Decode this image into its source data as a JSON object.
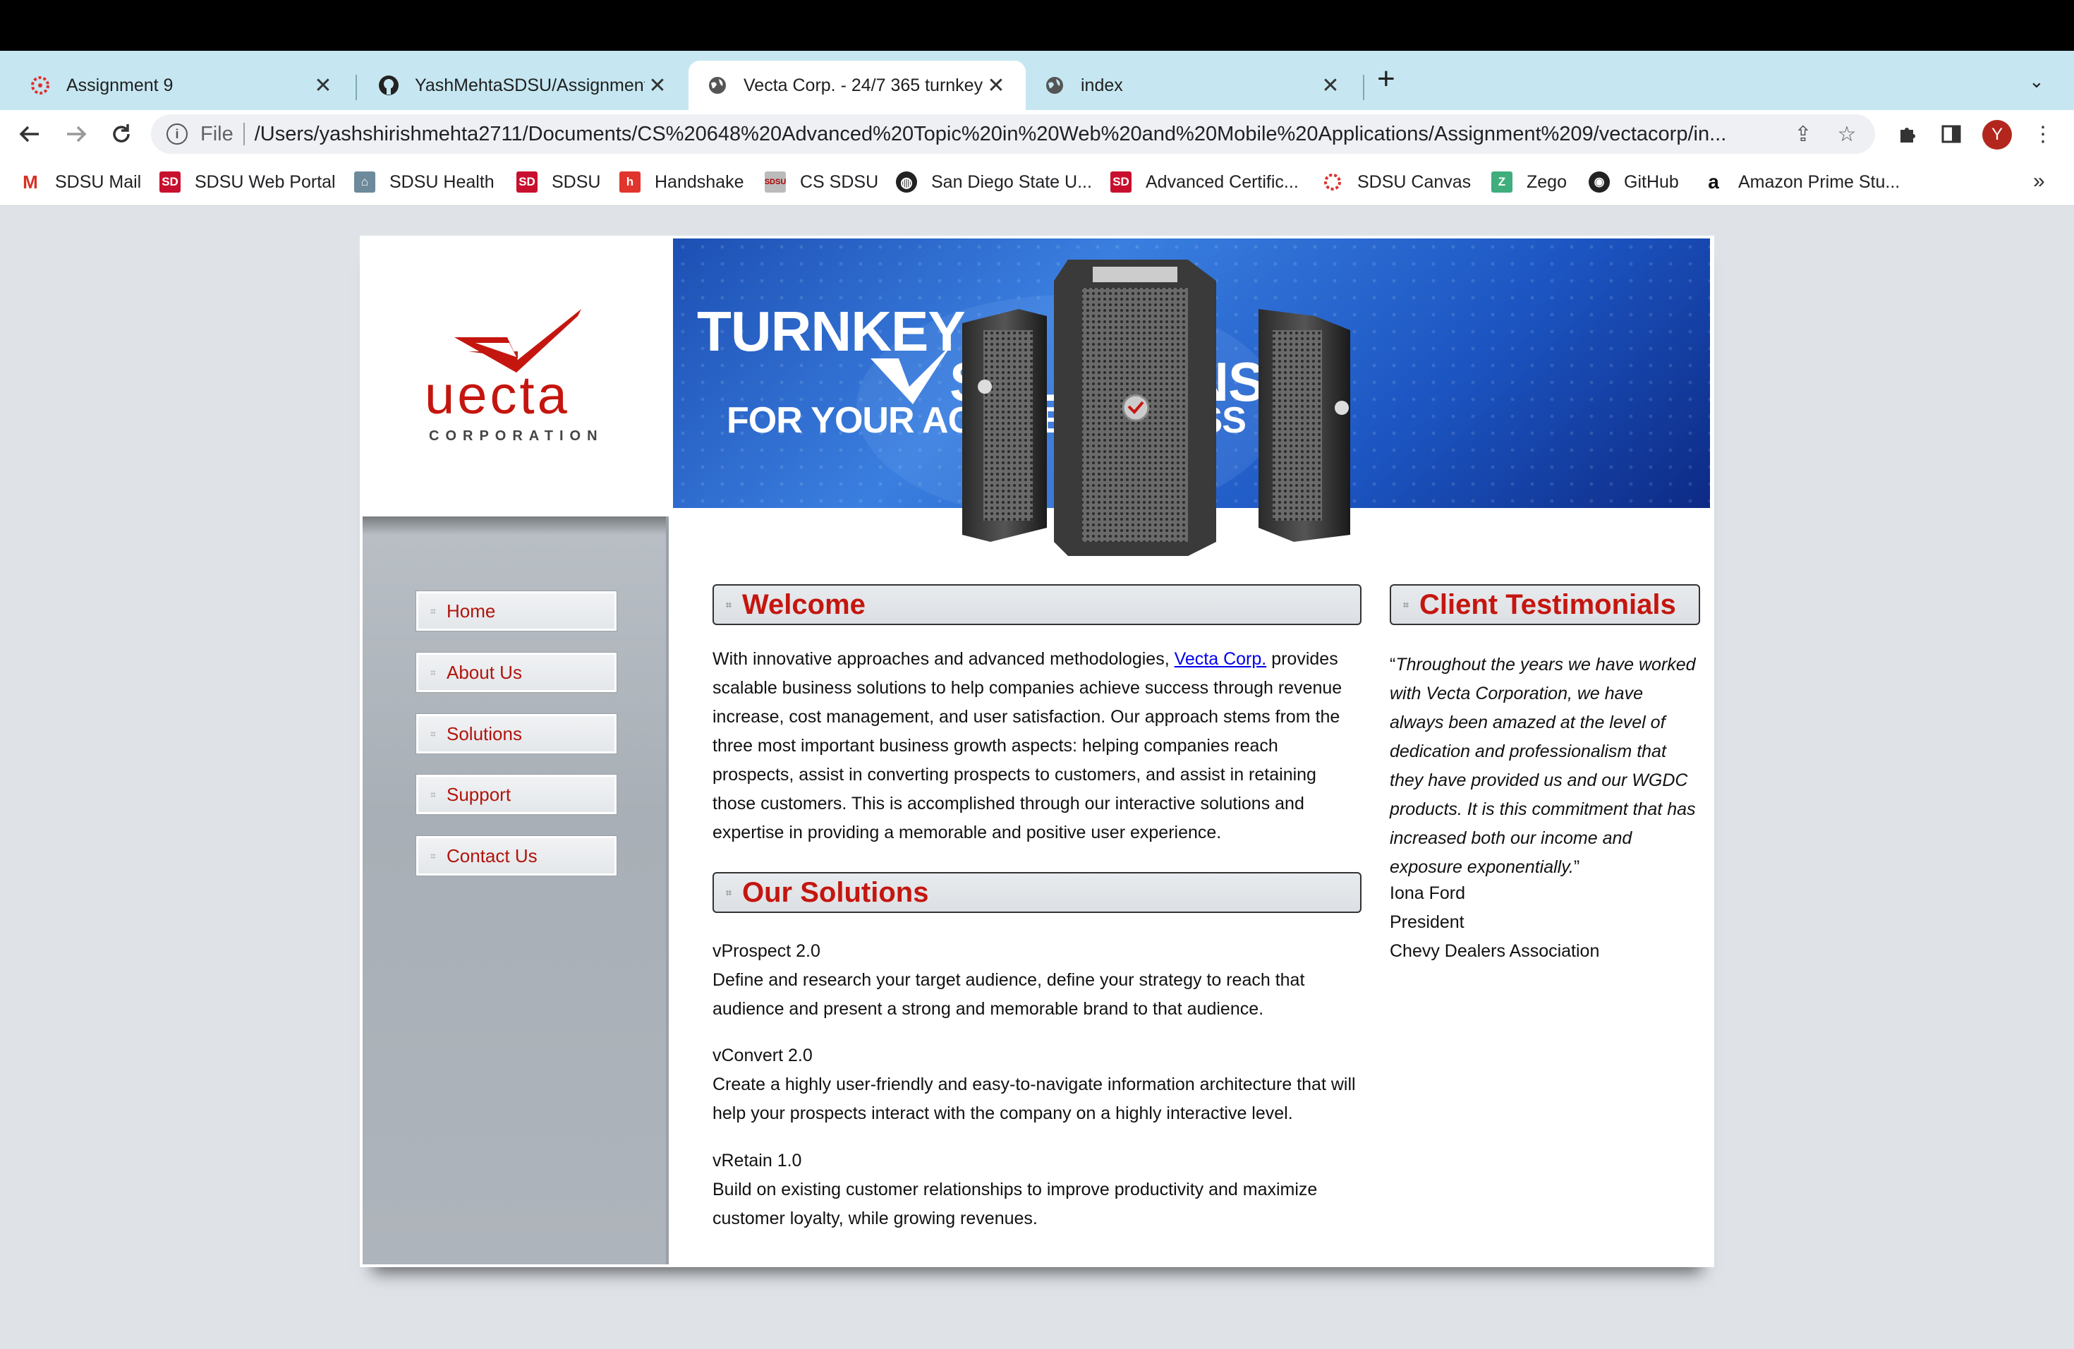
{
  "browser": {
    "tabs": [
      {
        "title": "Assignment 9",
        "icon": "canvas-icon",
        "active": false
      },
      {
        "title": "YashMehtaSDSU/Assignment-9",
        "icon": "github-icon",
        "active": false
      },
      {
        "title": "Vecta Corp. - 24/7 365 turnkey",
        "icon": "globe-icon",
        "active": true
      },
      {
        "title": "index",
        "icon": "globe-icon",
        "active": false
      }
    ],
    "address": {
      "scheme": "File",
      "url": "/Users/yashshirishmehta2711/Documents/CS%20648%20Advanced%20Topic%20in%20Web%20and%20Mobile%20Applications/Assignment%209/vectacorp/in..."
    },
    "avatar_letter": "Y",
    "bookmarks": [
      {
        "label": "SDSU Mail",
        "icon": "gmail-icon"
      },
      {
        "label": "SDSU Web Portal",
        "icon": "sdsu-icon"
      },
      {
        "label": "SDSU Health",
        "icon": "health-icon"
      },
      {
        "label": "SDSU",
        "icon": "sdsu-icon"
      },
      {
        "label": "Handshake",
        "icon": "handshake-icon"
      },
      {
        "label": "CS SDSU",
        "icon": "cs-icon"
      },
      {
        "label": "San Diego State U...",
        "icon": "globe-icon"
      },
      {
        "label": "Advanced Certific...",
        "icon": "sdsu-icon"
      },
      {
        "label": "SDSU Canvas",
        "icon": "canvas-icon"
      },
      {
        "label": "Zego",
        "icon": "zego-icon"
      },
      {
        "label": "GitHub",
        "icon": "github-icon"
      },
      {
        "label": "Amazon Prime Stu...",
        "icon": "amazon-icon"
      }
    ],
    "more_bookmarks": "»"
  },
  "site": {
    "logo": {
      "word": "uecta",
      "sub": "CORPORATION"
    },
    "banner": {
      "line1": "TURNKEY",
      "line2": "SOLUTIONS",
      "line3": "FOR YOUR AGILE EBUSINESS"
    },
    "nav": [
      "Home",
      "About Us",
      "Solutions",
      "Support",
      "Contact Us"
    ],
    "welcome": {
      "heading": "Welcome",
      "text_before": "With innovative approaches and advanced methodologies,",
      "link": "Vecta Corp.",
      "text_after": "provides scalable business solutions to help companies achieve success through revenue increase, cost management, and user satisfaction. Our approach stems from the three most important business growth aspects: helping companies reach prospects, assist in converting prospects to customers, and assist in retaining those customers. This is accomplished through our interactive solutions and expertise in providing a memorable and positive user experience."
    },
    "solutions": {
      "heading": "Our Solutions",
      "items": [
        {
          "name": "vProspect 2.0",
          "desc": "Define and research your target audience, define your strategy to reach that audience and present a strong and memorable brand to that audience."
        },
        {
          "name": "vConvert 2.0",
          "desc": "Create a highly user-friendly and easy-to-navigate information architecture that will help your prospects interact with the company on a highly interactive level."
        },
        {
          "name": "vRetain 1.0",
          "desc": "Build on existing customer relationships to improve productivity and maximize customer loyalty, while growing revenues."
        }
      ]
    },
    "testimonials": {
      "heading": "Client Testimonials",
      "quote": "Throughout the years we have worked with Vecta Corporation, we have always been amazed at the level of dedication and professionalism that they have provided us and our WGDC products. It is this commitment that has increased both our income and exposure exponentially.",
      "name": "Iona Ford",
      "title": "President",
      "org": "Chevy Dealers Association"
    },
    "colors": {
      "accent": "#c4160f",
      "link": "#0000ee",
      "sidebar": "#a8afb6"
    }
  }
}
